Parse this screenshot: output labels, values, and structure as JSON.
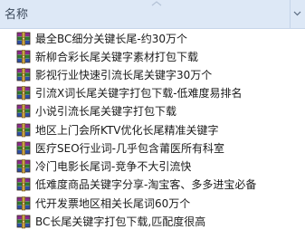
{
  "header": {
    "column_label": "名称"
  },
  "files": [
    {
      "name": "最全BC细分关键长尾-约30万个",
      "icon": "winrar-archive-icon"
    },
    {
      "name": "新柳合彩长尾关键字素材打包下载",
      "icon": "winrar-archive-icon"
    },
    {
      "name": "影视行业快速引流长尾关键字30万个",
      "icon": "winrar-archive-icon"
    },
    {
      "name": "引流X词长尾关键字打包下载-低难度易排名",
      "icon": "winrar-archive-icon"
    },
    {
      "name": "小说引流长尾关键字打包下载",
      "icon": "winrar-archive-icon"
    },
    {
      "name": "地区上门会所KTV优化长尾精准关键字",
      "icon": "winrar-archive-icon"
    },
    {
      "name": "医疗SEO行业词-几乎包含莆医所有科室",
      "icon": "winrar-archive-icon"
    },
    {
      "name": "冷门电影长尾词-竞争不大引流快",
      "icon": "winrar-archive-icon"
    },
    {
      "name": "低难度商品关键字分享-淘宝客、多多进宝必备",
      "icon": "winrar-archive-icon"
    },
    {
      "name": "代开发票地区相关长尾词60万个",
      "icon": "winrar-archive-icon"
    },
    {
      "name": "BC长尾关键字打包下载,匹配度很高",
      "icon": "winrar-archive-icon"
    }
  ]
}
